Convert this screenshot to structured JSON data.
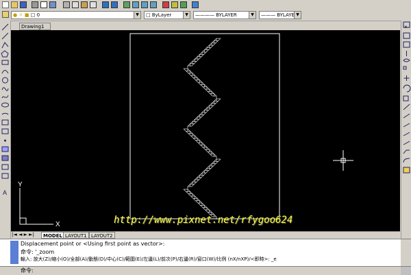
{
  "document_tab": "Drawing1",
  "layer_combo": {
    "value": "0"
  },
  "color_combo": {
    "value": "ByLayer"
  },
  "linetype_combo": {
    "value": "BYLAYER"
  },
  "lineweight_combo": {
    "value": "BYLAYER"
  },
  "ucs": {
    "x_label": "X",
    "y_label": "Y"
  },
  "layout_tabs": [
    "MODEL",
    "LAYOUT1",
    "LAYOUT2"
  ],
  "watermark": "http://www.pixnet.net/rfygoo624",
  "command_history": [
    "Displacement point or <Using first point as vector>:",
    "命令: '_zoom",
    "輸入: 放大(Z)/縮小(O)/全部(A)/動態(D)/中心(C)/範圍(E)/左邊(L)/前次(P)/右邊(R)/窗口(W)/比例 (nX/nXP)/<即時>: _e"
  ],
  "command_prompt": "命令:",
  "colors": {
    "canvas": "#000000",
    "watermark": "#ffff33",
    "ui": "#d4d0c8"
  }
}
